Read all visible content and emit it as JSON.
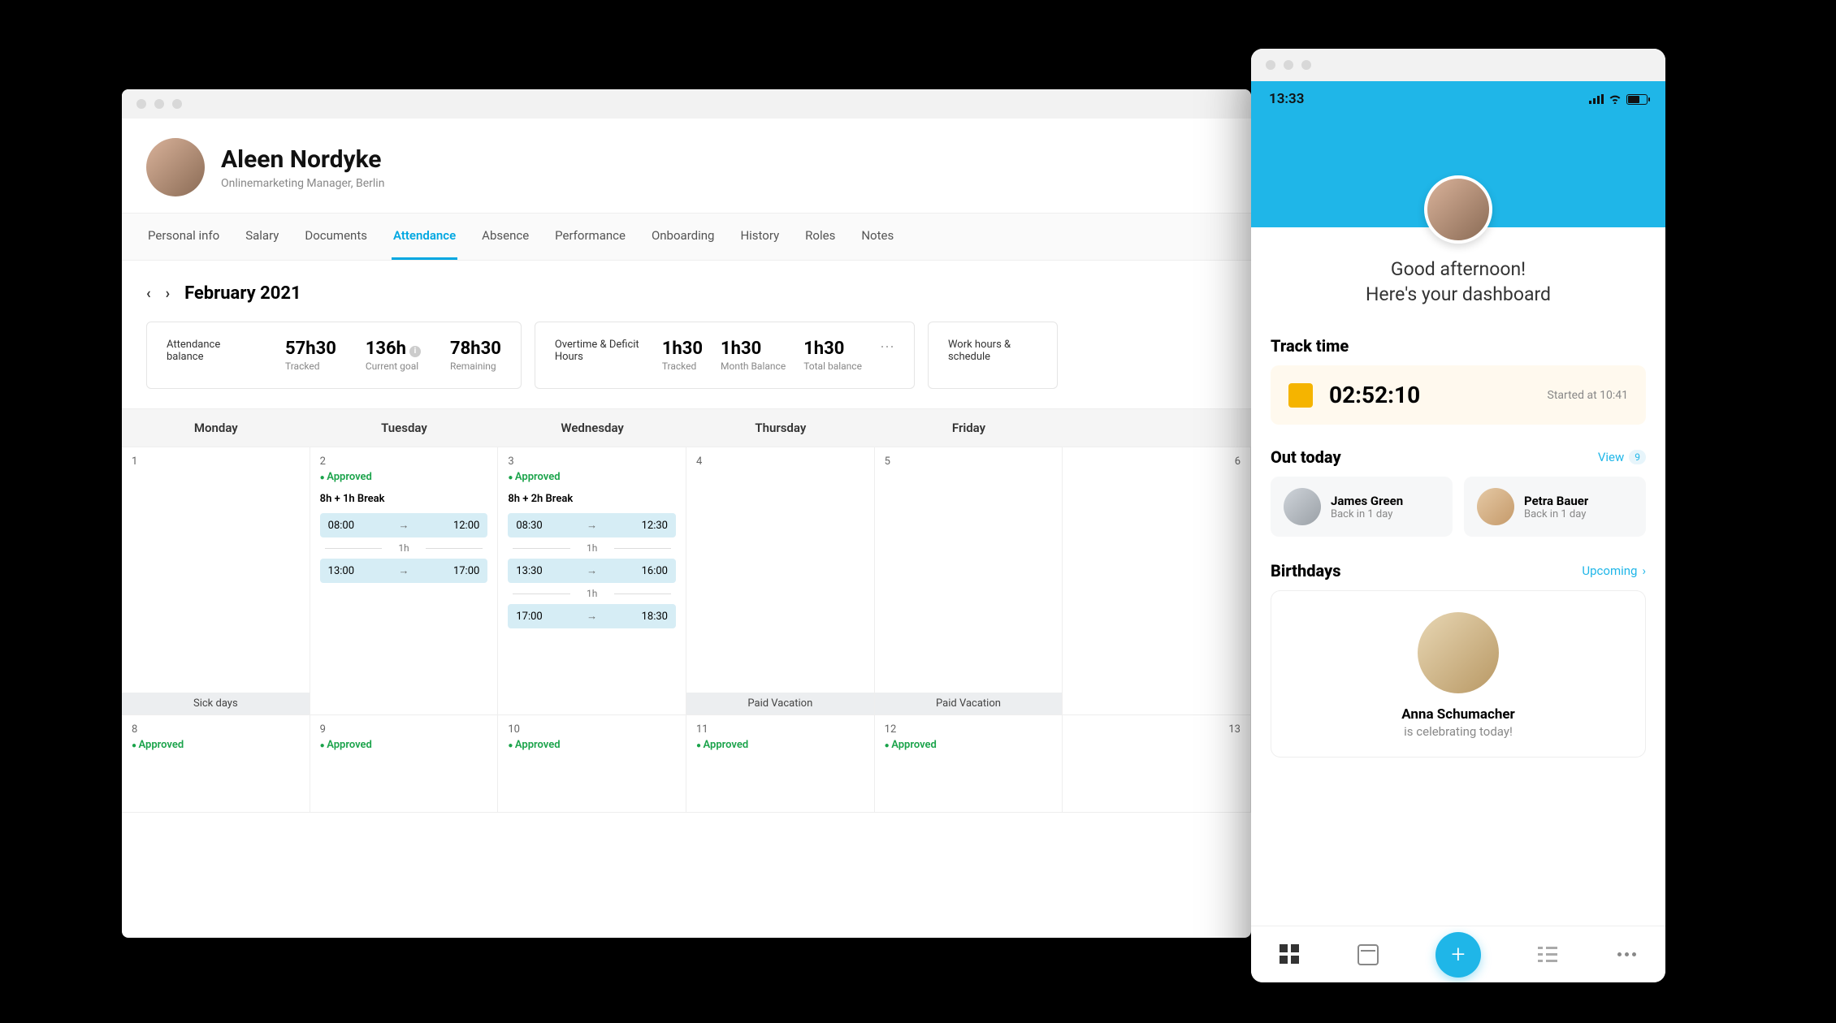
{
  "desktop": {
    "profile": {
      "name": "Aleen Nordyke",
      "subtitle": "Onlinemarketing Manager, Berlin"
    },
    "tabs": [
      {
        "label": "Personal info",
        "active": false
      },
      {
        "label": "Salary",
        "active": false
      },
      {
        "label": "Documents",
        "active": false
      },
      {
        "label": "Attendance",
        "active": true
      },
      {
        "label": "Absence",
        "active": false
      },
      {
        "label": "Performance",
        "active": false
      },
      {
        "label": "Onboarding",
        "active": false
      },
      {
        "label": "History",
        "active": false
      },
      {
        "label": "Roles",
        "active": false
      },
      {
        "label": "Notes",
        "active": false
      }
    ],
    "month": "February 2021",
    "stats": {
      "attendance": {
        "label": "Attendance balance",
        "tracked": {
          "val": "57h30",
          "sub": "Tracked"
        },
        "goal": {
          "val": "136h",
          "sub": "Current goal"
        },
        "remaining": {
          "val": "78h30",
          "sub": "Remaining"
        }
      },
      "overtime": {
        "label": "Overtime & Deficit Hours",
        "tracked": {
          "val": "1h30",
          "sub": "Tracked"
        },
        "month": {
          "val": "1h30",
          "sub": "Month Balance"
        },
        "total": {
          "val": "1h30",
          "sub": "Total balance"
        }
      },
      "extra": {
        "label": "Work hours & schedule"
      }
    },
    "calendar": {
      "headers": [
        "Monday",
        "Tuesday",
        "Wednesday",
        "Thursday",
        "Friday",
        ""
      ],
      "row1": {
        "mon": {
          "date": "1",
          "footer": "Sick days"
        },
        "tue": {
          "date": "2",
          "approved": "Approved",
          "shift": "8h + 1h Break",
          "blocks": [
            {
              "s": "08:00",
              "e": "12:00"
            },
            {
              "gap": "1h"
            },
            {
              "s": "13:00",
              "e": "17:00"
            }
          ]
        },
        "wed": {
          "date": "3",
          "approved": "Approved",
          "shift": "8h + 2h Break",
          "blocks": [
            {
              "s": "08:30",
              "e": "12:30"
            },
            {
              "gap": "1h"
            },
            {
              "s": "13:30",
              "e": "16:00"
            },
            {
              "gap": "1h"
            },
            {
              "s": "17:00",
              "e": "18:30"
            }
          ]
        },
        "thu": {
          "date": "4",
          "footer": "Paid Vacation"
        },
        "fri": {
          "date": "5",
          "footer": "Paid Vacation"
        },
        "sat": {
          "date": "6"
        }
      },
      "row2": {
        "mon": {
          "date": "8",
          "approved": "Approved"
        },
        "tue": {
          "date": "9",
          "approved": "Approved"
        },
        "wed": {
          "date": "10",
          "approved": "Approved"
        },
        "thu": {
          "date": "11",
          "approved": "Approved"
        },
        "fri": {
          "date": "12",
          "approved": "Approved"
        },
        "sat": {
          "date": "13"
        }
      }
    }
  },
  "phone": {
    "status_time": "13:33",
    "greeting_line1": "Good afternoon!",
    "greeting_line2": "Here's your dashboard",
    "track": {
      "title": "Track time",
      "elapsed": "02:52:10",
      "started": "Started at 10:41"
    },
    "out": {
      "title": "Out today",
      "view": "View",
      "count": "9",
      "items": [
        {
          "name": "James Green",
          "sub": "Back in 1 day"
        },
        {
          "name": "Petra Bauer",
          "sub": "Back in 1 day"
        }
      ]
    },
    "bday": {
      "title": "Birthdays",
      "link": "Upcoming",
      "name": "Anna Schumacher",
      "sub": "is celebrating today!"
    }
  }
}
